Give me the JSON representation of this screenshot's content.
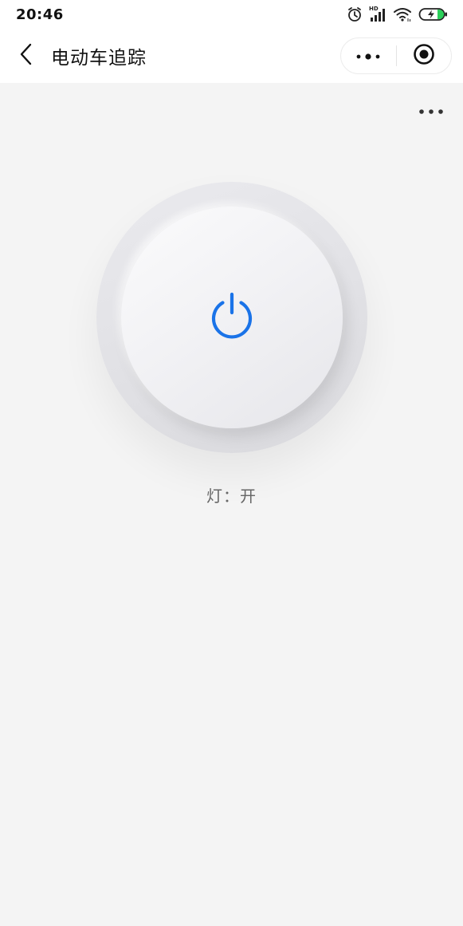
{
  "status_bar": {
    "time": "20:46",
    "icons": [
      "alarm-icon",
      "signal-hd-icon",
      "wifi-icon",
      "battery-charging-icon"
    ],
    "signal_badge": "HD"
  },
  "nav": {
    "title": "电动车追踪",
    "back_icon": "chevron-left-icon",
    "capsule_more_icon": "more-dots-icon",
    "capsule_close_icon": "target-circle-icon"
  },
  "main": {
    "more_icon": "more-horizontal-icon",
    "power_icon": "power-icon",
    "light_status": "灯：开"
  },
  "colors": {
    "accent": "#1a73e8",
    "background": "#f4f4f4",
    "battery_green": "#2bd05a"
  }
}
